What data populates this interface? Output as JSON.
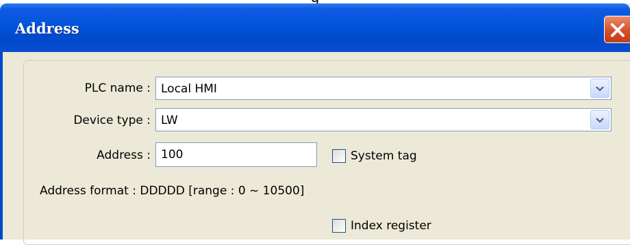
{
  "window": {
    "title": "Address",
    "top_text": "g"
  },
  "form": {
    "plc_name": {
      "label": "PLC name :",
      "value": "Local HMI"
    },
    "device_type": {
      "label": "Device type :",
      "value": "LW"
    },
    "address": {
      "label": "Address :",
      "value": "100"
    },
    "system_tag": {
      "label": "System tag",
      "checked": false
    },
    "address_format": {
      "text": "Address format :  DDDDD [range : 0 ~ 10500]"
    },
    "index_register": {
      "label": "Index register",
      "checked": false
    }
  },
  "icons": {
    "close": "close-icon",
    "dropdown": "chevron-down-icon"
  },
  "colors": {
    "titlebar": "#0453d8",
    "close": "#d4502a",
    "background": "#ece9d8"
  }
}
